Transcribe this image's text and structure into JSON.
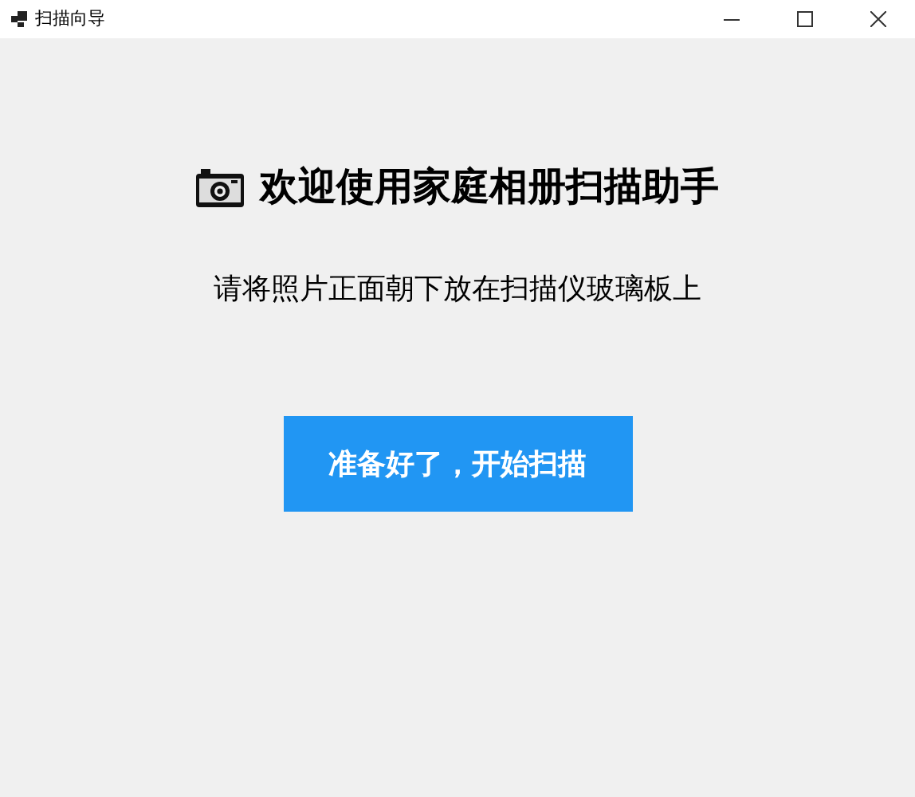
{
  "window": {
    "title": "扫描向导"
  },
  "heading": "欢迎使用家庭相册扫描助手",
  "instruction": "请将照片正面朝下放在扫描仪玻璃板上",
  "start_button": "准备好了，开始扫描"
}
